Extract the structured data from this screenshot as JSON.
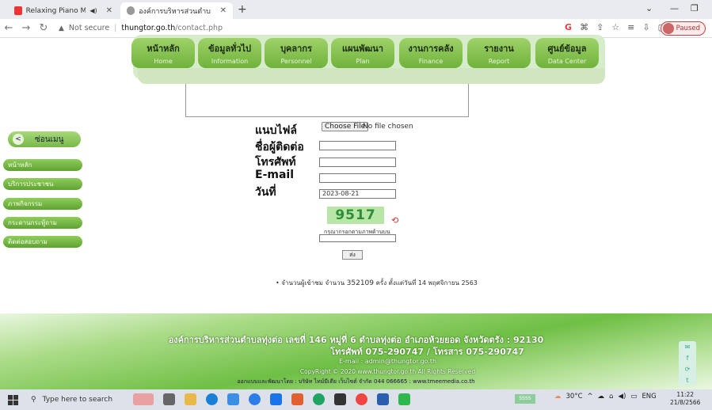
{
  "browser": {
    "tabs": [
      {
        "label": "Relaxing Piano Music: Roma",
        "active": false
      },
      {
        "label": "องค์การบริหารส่วนตำบลทุ่งต่อ อำเภ",
        "active": true
      }
    ],
    "new_tab": "+",
    "url_not_secure": "Not secure",
    "url_host": "thungtor.go.th",
    "url_path": "/contact.php",
    "profile_label": "Paused",
    "window_controls": [
      "⌄",
      "—",
      "❐"
    ]
  },
  "site_nav": [
    {
      "th": "หน้าหลัก",
      "en": "Home"
    },
    {
      "th": "ข้อมูลทั่วไป",
      "en": "Information"
    },
    {
      "th": "บุคลากร",
      "en": "Personnel"
    },
    {
      "th": "แผนพัฒนา",
      "en": "Plan"
    },
    {
      "th": "งานการคลัง",
      "en": "Finance"
    },
    {
      "th": "รายงาน",
      "en": "Report"
    },
    {
      "th": "ศูนย์ข้อมูล",
      "en": "Data Center"
    }
  ],
  "side_menu": {
    "header": "ซ่อนเมนู",
    "items": [
      "หน้าหลัก",
      "บริการประชาชน",
      "ภาพกิจกรรม",
      "กระดานกระทู้ถาม",
      "ติดต่อสอบถาม"
    ]
  },
  "form": {
    "attach_label": "แนบไฟล์",
    "choose_file": "Choose File",
    "no_file": "No file chosen",
    "contact_name_label": "ชื่อผู้ติดต่อ",
    "contact_name_value": "",
    "phone_label": "โทรศัพท์",
    "phone_value": "",
    "email_label": "E-mail",
    "email_value": "",
    "date_label": "วันที่",
    "date_value": "2023-08-21",
    "captcha": "9517",
    "captcha_note": "กรุณากรอกตามภาพด้านบน",
    "submit": "ส่ง"
  },
  "counter": {
    "prefix": "• จำนวนผู้เข้าชม จำนวน",
    "count": "352109",
    "suffix": "ครั้ง ตั้งแต่วันที่ 14 พฤศจิกายน 2563"
  },
  "footer": {
    "line1": "องค์การบริหารส่วนตำบลทุ่งต่อ เลขที่ 146 หมู่ที่ 6 ตำบลทุ่งต่อ อำเภอห้วยยอด จังหวัดตรัง : 92130",
    "line2": "โทรศัพท์ 075-290747 / โทรสาร 075-290747",
    "line3": "E-mail : admin@thungtor.go.th",
    "line4": "CopyRight © 2020 www.thungtor.go.th All Rights Reserved",
    "line5": "ออกแบบและพัฒนาโดย : บริษัท ไทม์มีเดีย เว็บไซต์ จำกัด 044 066665 : www.tmeemedia.co.th"
  },
  "taskbar": {
    "search_placeholder": "Type here to search",
    "weather": "30°C",
    "lang": "ENG",
    "time": "11:22",
    "date": "21/8/2566",
    "pinned_label": "SSSS"
  },
  "colors": {
    "nav_green": "#7fbf46",
    "captcha_bg": "#b7e6a6",
    "footer_green": "#6fbf45"
  }
}
